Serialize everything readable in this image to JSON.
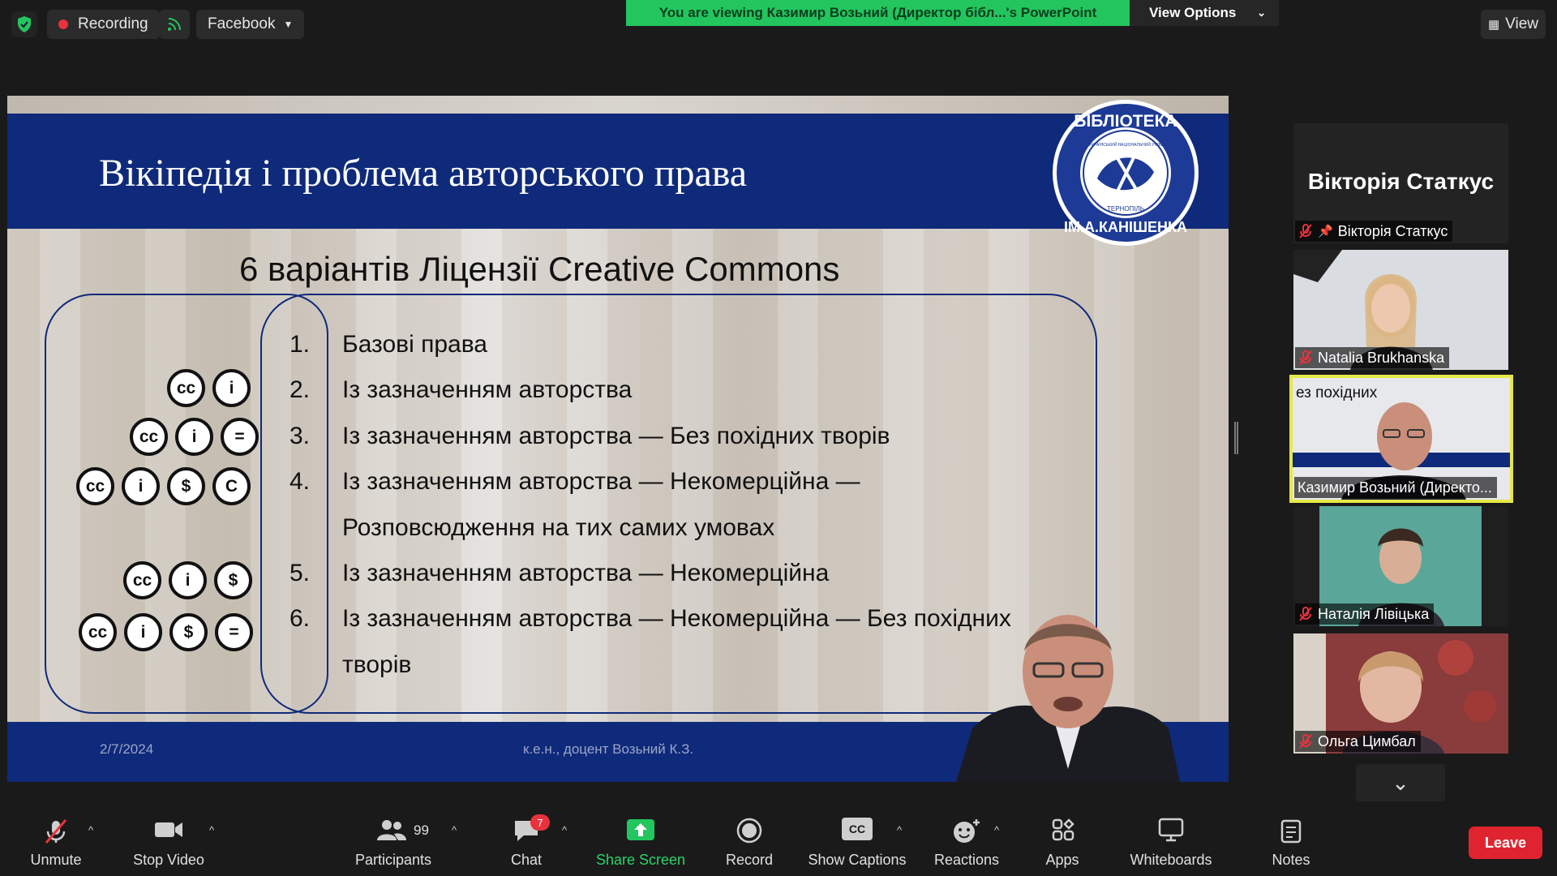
{
  "top_bar": {
    "recording_label": "Recording",
    "facebook_label": "Facebook",
    "viewing_banner": "You are viewing Казимир Возьний (Директор бібл...'s PowerPoint",
    "view_options_label": "View Options",
    "view_label": "View"
  },
  "slide": {
    "title": "Вікіпедія і проблема авторського права",
    "subtitle": "6 варіантів Ліцензії Creative Commons",
    "items": [
      {
        "num": "1.",
        "text": "Базові права"
      },
      {
        "num": "2.",
        "text": "Із зазначенням авторства"
      },
      {
        "num": "3.",
        "text": "Із зазначенням авторства — Без похідних творів"
      },
      {
        "num": "4.",
        "text": "Із зазначенням авторства — Некомерційна —"
      },
      {
        "num": "",
        "text": "Розповсюдження на тих самих умовах"
      },
      {
        "num": "5.",
        "text": "Із зазначенням авторства — Некомерційна"
      },
      {
        "num": "6.",
        "text": "Із зазначенням авторства — Некомерційна — Без похідних"
      },
      {
        "num": "",
        "text": "творів"
      }
    ],
    "cc_labels": {
      "cc": "cc",
      "by": "i",
      "nd": "=",
      "nc": "$",
      "sa": "C"
    },
    "logo_text_top": "БІБЛІОТЕКА",
    "logo_text_bottom": "ІМ.А.КАНІШЕНКА",
    "logo_text_inner": "ЗАХІДНОУКРАЇНСЬКИЙ НАЦІОНАЛЬНИЙ УНІВЕРСИТЕТ",
    "logo_city": "ТЕРНОПІЛЬ",
    "footer_date": "2/7/2024",
    "footer_author": "к.е.н., доцент Возьний К.З.",
    "colors": {
      "band": "#0f2a7a"
    }
  },
  "participants_panel": {
    "tiles": [
      {
        "big_name": "Вікторія Статкус",
        "name": "Вікторія Статкус",
        "pinned": true
      },
      {
        "name": "Natalia Brukhanska"
      },
      {
        "name": "Казимир Возьний (Директо...",
        "overlay_text": "ез похідних",
        "active": true
      },
      {
        "name": "Наталія Лівіцька"
      },
      {
        "name": "Ольга Цимбал"
      }
    ]
  },
  "toolbar": {
    "unmute": "Unmute",
    "stop_video": "Stop Video",
    "participants": "Participants",
    "participants_count": "99",
    "chat": "Chat",
    "chat_badge": "7",
    "share_screen": "Share Screen",
    "record": "Record",
    "show_captions": "Show Captions",
    "captions_icon_text": "CC",
    "reactions": "Reactions",
    "apps": "Apps",
    "whiteboards": "Whiteboards",
    "notes": "Notes",
    "leave": "Leave",
    "colors": {
      "share": "#2bd36a",
      "leave": "#e0242f",
      "badge": "#e8323c"
    }
  }
}
